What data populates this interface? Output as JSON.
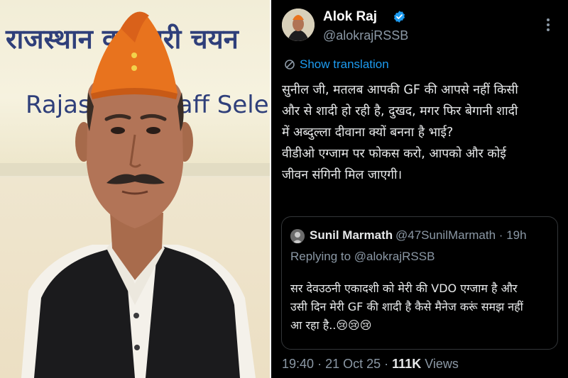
{
  "photo": {
    "sign_hindi": "राजस्थान कर्मचारी चयन",
    "sign_english": "Rajasthan Staff Selection Bo"
  },
  "tweet": {
    "author": {
      "name": "Alok Raj",
      "handle": "@alokrajRSSB",
      "verified": true
    },
    "show_translation": "Show translation",
    "body_lines": [
      "सुनील जी, मतलब आपकी GF की आपसे नहीं किसी",
      "और से शादी हो रही है, दुखद, मगर फिर बेगानी शादी",
      "में अब्दुल्ला दीवाना क्यों बनना है भाई?",
      "वीडीओ एग्जाम पर फोकस करो, आपको और कोई",
      "जीवन संगिनी मिल जाएगी।"
    ],
    "quoted": {
      "name": "Sunil Marmath",
      "handle": "@47SunilMarmath",
      "separator": "·",
      "age": "19h",
      "replying_prefix": "Replying to",
      "replying_to": "@alokrajRSSB",
      "body_lines": [
        "सर देवउठनी एकादशी को मेरी की VDO एग्जाम है और",
        "उसी दिन मेरी GF की शादी है कैसे मैनेज करूं समझ नहीं",
        "आ रहा है..😢😢😢"
      ]
    },
    "time": "19:40",
    "date_separator": "·",
    "date": "21 Oct 25",
    "views_separator": "·",
    "views_count": "111K",
    "views_label": "Views"
  },
  "colors": {
    "tweet_bg": "#000000",
    "link_blue": "#1d9bf0",
    "muted_text": "#8b98a5",
    "primary_text": "#e7e9ea",
    "sign_blue": "#2f3f7a",
    "cap_saffron": "#e8731e"
  },
  "icons": {
    "verified": "verified-badge-icon",
    "more": "more-vertical-icon",
    "translate": "translate-icon"
  }
}
